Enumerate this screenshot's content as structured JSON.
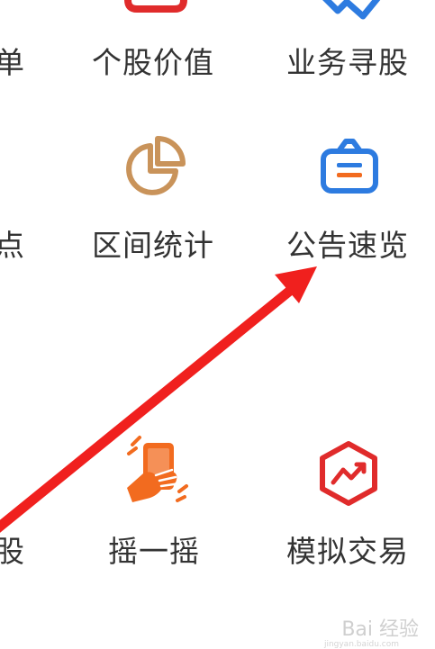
{
  "grid": {
    "row1": {
      "left_partial": "单",
      "middle": "个股价值",
      "right": "业务寻股"
    },
    "row2": {
      "left_partial": "点",
      "middle": "区间统计",
      "right": "公告速览"
    },
    "row3": {
      "left_partial": "股",
      "middle": "摇一摇",
      "right": "模拟交易"
    }
  },
  "icons": {
    "row1_middle": "red-document-icon",
    "row1_right": "blue-chart-icon",
    "row2_middle": "pie-chart-icon",
    "row2_right": "announcement-bag-icon",
    "row3_middle": "shake-phone-hand-icon",
    "row3_right": "simulated-trade-hexagon-icon"
  },
  "colors": {
    "label": "#333333",
    "pie": "#C9935A",
    "blue": "#2D7BE0",
    "orange": "#F26B1F",
    "red": "#E02B2B",
    "arrow": "#F0201E"
  },
  "watermark": {
    "text": "Bai 经验",
    "sub": "jingyan.baidu.com"
  }
}
